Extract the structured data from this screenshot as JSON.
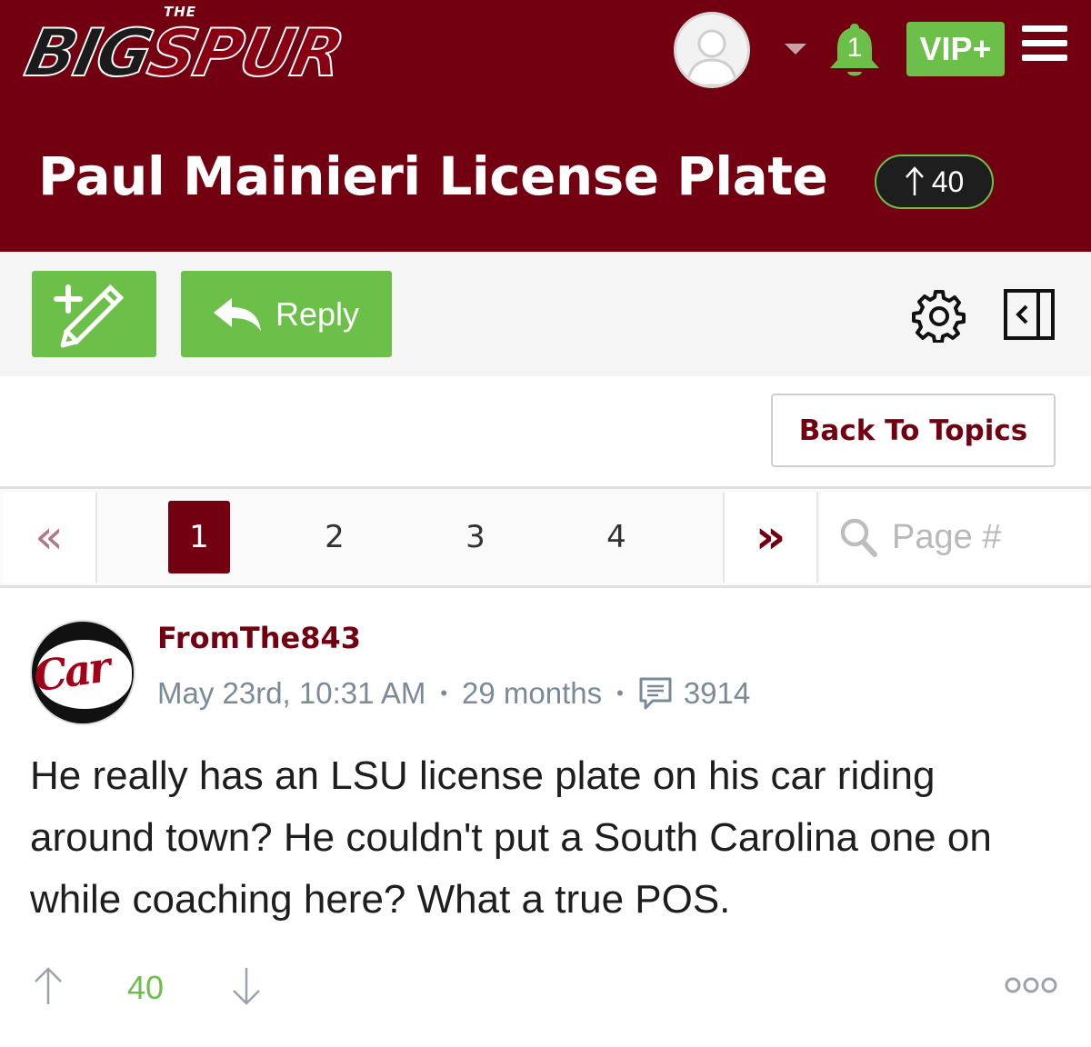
{
  "brand": {
    "the": "THE",
    "word_big": "BIG",
    "word_spur": "SPUR",
    "primary_color": "#730010",
    "accent_green": "#6cc04a"
  },
  "header": {
    "notifications_count": "1",
    "vip_label": "VIP+"
  },
  "topic": {
    "title": "Paul Mainieri License Plate",
    "score": "40"
  },
  "toolbar": {
    "new_topic_icon": "new-post-pencil-icon",
    "reply_label": "Reply",
    "settings_icon": "gear-icon",
    "panel_icon": "collapse-panel-icon"
  },
  "back_to_topics": "Back To Topics",
  "pagination": {
    "first": "«",
    "pages": [
      "1",
      "2",
      "3",
      "4"
    ],
    "current_page": "1",
    "next": "»",
    "page_input_placeholder": "Page #"
  },
  "post": {
    "username": "FromThe843",
    "timestamp": "May 23rd, 10:31 AM",
    "member_for": "29 months",
    "post_count": "3914",
    "body": "He really has an LSU license plate on his car riding around town? He couldn't put a South Carolina one on while coaching here? What a true POS.",
    "score": "40"
  }
}
